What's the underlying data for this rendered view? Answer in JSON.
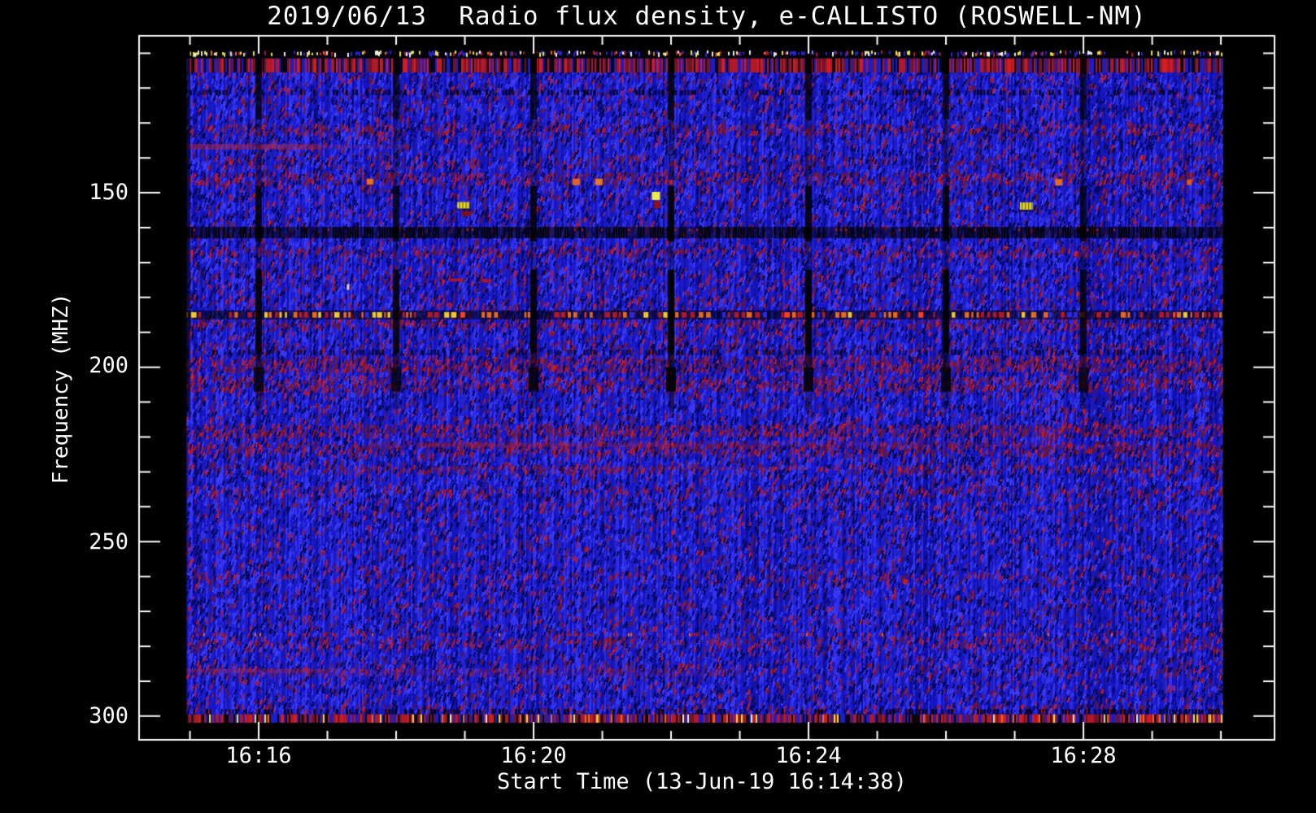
{
  "station": "ROSWELL-NM",
  "date": "2019/06/13",
  "chart_data": {
    "type": "heatmap",
    "subtype": "radio-spectrogram",
    "title": "2019/06/13  Radio flux density, e-CALLISTO (ROSWELL-NM)",
    "xlabel": "Start Time (13-Jun-19 16:14:38)",
    "ylabel": "Frequency (MHZ)",
    "x_tick_labels": [
      "16:16",
      "16:20",
      "16:24",
      "16:28"
    ],
    "x_tick_minutes": [
      16,
      20,
      24,
      28
    ],
    "x_minor_step_minutes": 1,
    "x_range_minutes_after_1600": [
      14.26,
      30.78
    ],
    "y_tick_labels": [
      "150",
      "200",
      "250",
      "300"
    ],
    "y_tick_values_mhz": [
      150,
      200,
      250,
      300
    ],
    "y_minor_step_mhz": 10,
    "y_range_mhz": [
      105.0,
      306.8
    ],
    "y_axis_inverted": true,
    "grid": false,
    "legend": "none",
    "data_extent": {
      "t_min": 14.95,
      "t_max": 30.03,
      "f_min_mhz": 109,
      "f_max_mhz": 302
    },
    "colors": {
      "background": "#000000",
      "axis": "#ffffff",
      "base_blue": "#1e1ed7",
      "navy": "#050550",
      "maroon": "#6e142d",
      "red": "#af1928",
      "bright_red": "#d21e1e",
      "orange": "#e66a1e",
      "yellow": "#ebe13c",
      "white_speck": "#ebebeb"
    },
    "blackout_stripe_minutes": [
      16,
      18,
      20,
      22,
      24,
      26,
      28
    ],
    "stripe_segments_f_alpha": [
      [
        109,
        116,
        1.0
      ],
      [
        116,
        129,
        0.75
      ],
      [
        129,
        148,
        0.3
      ],
      [
        148,
        164,
        0.85
      ],
      [
        164,
        172,
        0.25
      ],
      [
        172,
        196,
        0.92
      ],
      [
        196,
        200,
        0.55
      ],
      [
        200,
        207,
        0.85
      ],
      [
        207,
        212,
        0.35
      ]
    ],
    "rfi_bands": [
      {
        "name": "top-edge-speckle",
        "f_mhz": [
          109,
          111.5
        ],
        "style": "yellow-white-red-dashes-on-black"
      },
      {
        "name": "top-red-band",
        "f_mhz": [
          111.5,
          115.5
        ],
        "style": "dense-red-speckle"
      },
      {
        "name": "dark-dash-row-121",
        "f_mhz": [
          120.5,
          122
        ],
        "style": "black-dashes"
      },
      {
        "name": "dark-band-161",
        "f_mhz": [
          159.8,
          163.0
        ],
        "style": "black-dashes-sparse-red"
      },
      {
        "name": "orange-dash-line-185",
        "f_mhz": [
          184.2,
          185.8
        ],
        "style": "orange-red-yellow-dashes"
      },
      {
        "name": "dark-dash-row-196",
        "f_mhz": [
          195.0,
          196.5
        ],
        "style": "black-dashes"
      },
      {
        "name": "red-dash-row-277",
        "f_mhz": [
          276.0,
          277.5
        ],
        "style": "sparse-red-dashes"
      },
      {
        "name": "dark-dash-row-299",
        "f_mhz": [
          298.0,
          299.5
        ],
        "style": "black-dashes"
      },
      {
        "name": "bottom-red-speckle",
        "f_mhz": [
          299.5,
          302
        ],
        "style": "dense-red-speckle"
      }
    ],
    "diffuse_streaks": [
      {
        "f_mhz": 136.8,
        "t0": 14.95,
        "t1": 16.9,
        "h": 7,
        "alpha": 0.5
      },
      {
        "f_mhz": 136.8,
        "t0": 16.9,
        "t1": 18.2,
        "h": 5,
        "alpha": 0.2
      },
      {
        "f_mhz": 222.0,
        "t0": 17.6,
        "t1": 27.6,
        "h": 8,
        "alpha": 0.14
      },
      {
        "f_mhz": 222.3,
        "t0": 18.3,
        "t1": 22.3,
        "h": 5,
        "alpha": 0.24
      },
      {
        "f_mhz": 229.0,
        "t0": 18.5,
        "t1": 24.0,
        "h": 4,
        "alpha": 0.22
      },
      {
        "f_mhz": 287.5,
        "t0": 14.95,
        "t1": 23.0,
        "h": 10,
        "alpha": 0.15
      },
      {
        "f_mhz": 287.0,
        "t0": 14.95,
        "t1": 17.0,
        "h": 5,
        "alpha": 0.3
      }
    ],
    "bright_spots": [
      {
        "t": 17.62,
        "f": 146.8,
        "w": 8,
        "h": 7,
        "color": "#e07020"
      },
      {
        "t": 18.98,
        "f": 153.6,
        "w": 15,
        "h": 8,
        "color": "#e8dc30",
        "striped": true
      },
      {
        "t": 19.02,
        "f": 156.0,
        "w": 12,
        "h": 6,
        "color": "#7a1020"
      },
      {
        "t": 18.88,
        "f": 175.0,
        "w": 16,
        "h": 4,
        "color": "#a81828"
      },
      {
        "t": 19.32,
        "f": 175.2,
        "w": 12,
        "h": 4,
        "color": "#a81828"
      },
      {
        "t": 17.3,
        "f": 177.0,
        "w": 3,
        "h": 7,
        "color": "#d8d8e0"
      },
      {
        "t": 20.62,
        "f": 146.9,
        "w": 9,
        "h": 8,
        "color": "#e06424"
      },
      {
        "t": 20.95,
        "f": 146.9,
        "w": 9,
        "h": 8,
        "color": "#e87828"
      },
      {
        "t": 22.0,
        "f": 147.0,
        "w": 5,
        "h": 6,
        "color": "#b82020"
      },
      {
        "t": 21.78,
        "f": 150.9,
        "w": 10,
        "h": 10,
        "color": "#f0ec48"
      },
      {
        "t": 21.8,
        "f": 153.5,
        "w": 8,
        "h": 8,
        "color": "#901018"
      },
      {
        "t": 27.17,
        "f": 153.8,
        "w": 16,
        "h": 9,
        "color": "#e0d82c",
        "striped": true
      },
      {
        "t": 27.64,
        "f": 147.0,
        "w": 9,
        "h": 8,
        "color": "#e06c24"
      },
      {
        "t": 29.54,
        "f": 147.0,
        "w": 6,
        "h": 7,
        "color": "#d85c20"
      }
    ]
  }
}
